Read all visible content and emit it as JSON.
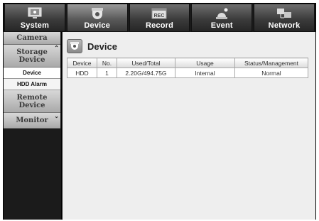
{
  "topbar": {
    "tabs": [
      {
        "label": "System",
        "icon": "monitor-icon"
      },
      {
        "label": "Device",
        "icon": "camera-dome-icon"
      },
      {
        "label": "Record",
        "icon": "rec-icon",
        "icon_text": "REC"
      },
      {
        "label": "Event",
        "icon": "alarm-icon"
      },
      {
        "label": "Network",
        "icon": "network-icon"
      }
    ],
    "active": "Device"
  },
  "sidebar": {
    "camera": "Camera",
    "storage": "Storage Device",
    "storage_subs": [
      "Device",
      "HDD Alarm"
    ],
    "remote": "Remote Device",
    "monitor": "Monitor"
  },
  "main": {
    "title": "Device",
    "table": {
      "headers": [
        "Device",
        "No.",
        "Used/Total",
        "Usage",
        "Status/Management"
      ],
      "rows": [
        [
          "HDD",
          "1",
          "2.20G/494.75G",
          "Internal",
          "Normal"
        ]
      ]
    }
  }
}
